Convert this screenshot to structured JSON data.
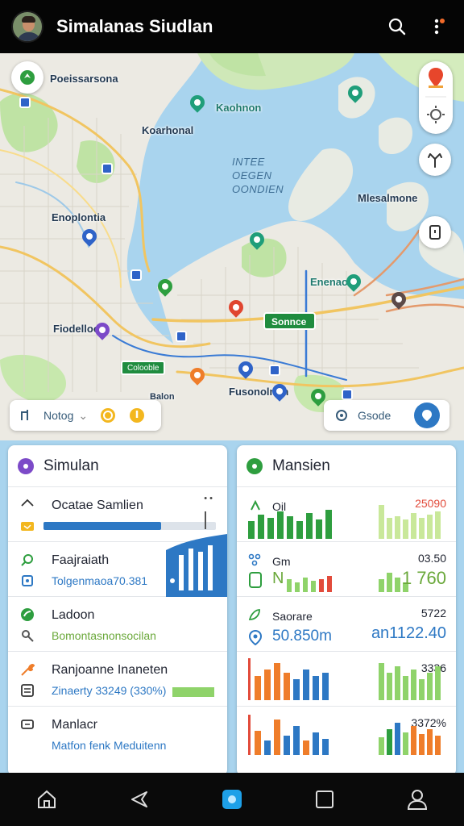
{
  "header": {
    "title": "Simalanas Siudlan"
  },
  "map": {
    "labels": {
      "north_west": "Poeissarsona",
      "north_center": "Kaohnon",
      "center_west": "Koarhonal",
      "west": "Enoplontia",
      "water_center": "INTEE\nOEGEN\nOONDIEN",
      "east": "Mlesalmone",
      "southwest": "Fiodelloo",
      "bay": "Enenaoe",
      "bottom_left": "Balon",
      "bottom_center": "Fusonolnon"
    },
    "station_chip": "Sonnce",
    "small_chip": "Colooble",
    "left_pill_label": "Notog",
    "right_pill_label": "Gsode"
  },
  "left_panel": {
    "title": "Simulan",
    "rows": [
      {
        "line1": "Ocatae Samlien",
        "line2": "",
        "progress": 0.68
      },
      {
        "line1": "Faajraiath",
        "line2": "Tolgenmaoa70.381"
      },
      {
        "line1": "Ladoon",
        "line2": "Bomontasnonsocilan"
      },
      {
        "line1": "Ranjoanne Inaneten",
        "line2": "Zinaerty 33249 (330%)"
      },
      {
        "line1": "Manlacr",
        "line2": "Matfon fenk Meduitenn"
      }
    ]
  },
  "right_panel": {
    "title": "Mansien",
    "rows": [
      {
        "label": "Oil",
        "value": "25090",
        "big": "",
        "big_right": ""
      },
      {
        "label": "Gm",
        "value": "03.50",
        "big": "",
        "big_right": ""
      },
      {
        "label": "Saorare",
        "value": "5722",
        "big": "50.850m",
        "big_right": "an1122.40"
      },
      {
        "label": "",
        "value": "3336",
        "big": "",
        "big_right": ""
      },
      {
        "label": "",
        "value": "3372%",
        "big": "",
        "big_right": ""
      }
    ],
    "mid_labels": [
      "N",
      "1 760"
    ]
  },
  "colors": {
    "accent_blue": "#2d78c4",
    "green": "#2e9e3f",
    "orange": "#ef7d2a"
  }
}
